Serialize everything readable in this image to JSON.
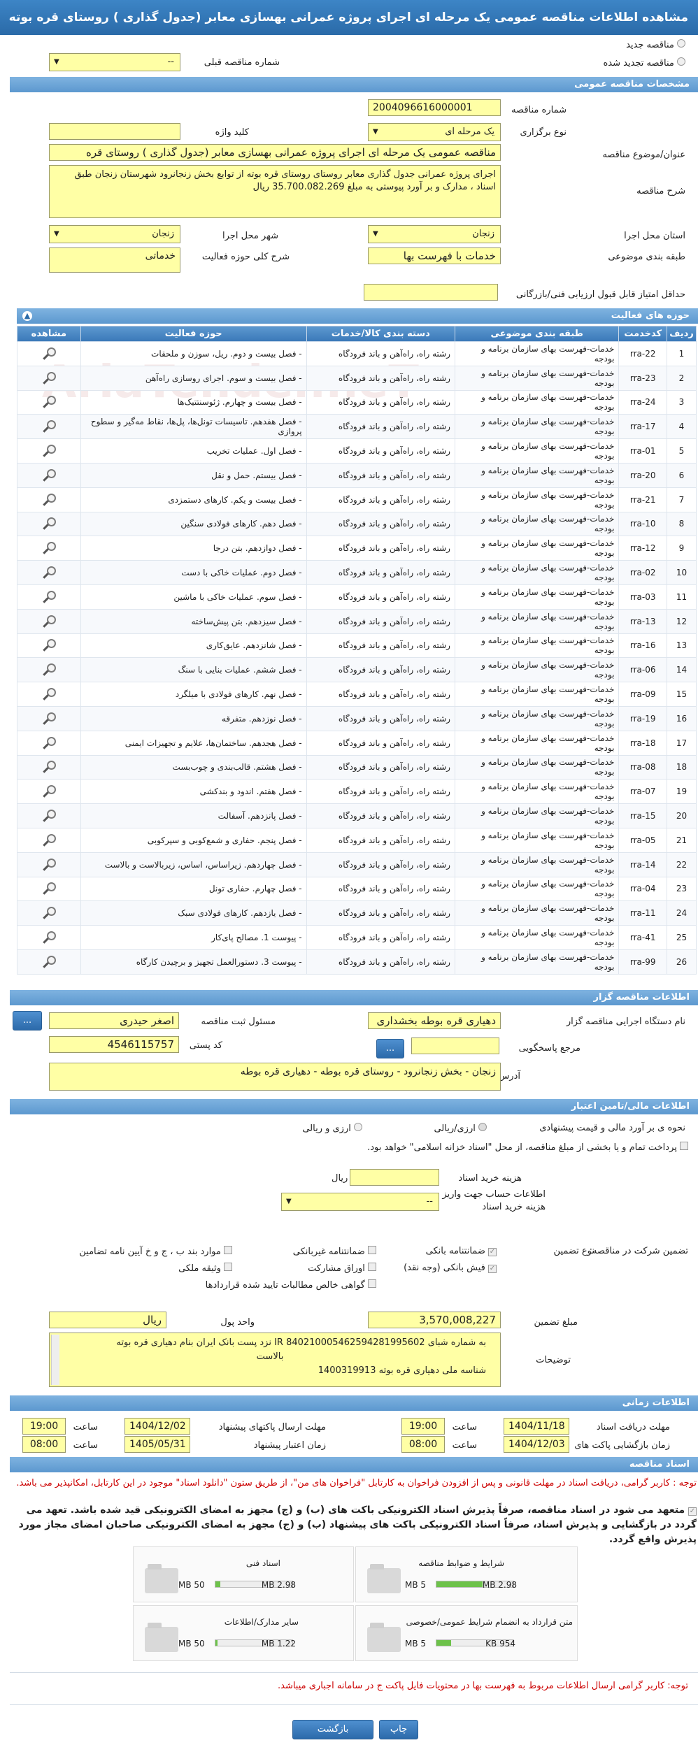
{
  "page": {
    "title": "مشاهده اطلاعات مناقصه عمومی یک مرحله ای اجرای پروژه عمرانی بهسازی معابر (جدول گذاری ) روستای قره بوته"
  },
  "tender_type": {
    "new_label": "مناقصه جدید",
    "renewed_label": "مناقصه تجدید شده",
    "prev_number_label": "شماره مناقصه قبلی",
    "prev_number_value": "--"
  },
  "general": {
    "header": "مشخصات مناقصه عمومی",
    "number_label": "شماره مناقصه",
    "number_value": "2004096616000001",
    "holding_label": "نوع برگزاری",
    "holding_value": "یک مرحله ای",
    "keyword_label": "کلید واژه",
    "keyword_value": "",
    "subject_label": "عنوان/موضوع مناقصه",
    "subject_value": "مناقصه عمومی یک مرحله ای اجرای پروژه عمرانی بهسازی معابر (جدول گذاری ) روستای قره",
    "desc_label": "شرح مناقصه",
    "desc_value": "اجرای پروژه عمرانی جدول گذاری معابر روستای روستای قره بوته از توابع بخش زنجانرود شهرستان زنجان طبق اسناد ، مدارک و بر آورد پیوستی به مبلغ 35.700.082.269 ریال",
    "province_label": "استان محل اجرا",
    "province_value": "زنجان",
    "city_label": "شهر محل اجرا",
    "city_value": "زنجان",
    "category_label": "طبقه بندی موضوعی",
    "category_value": "خدمات با فهرست بها",
    "activity_label": "شرح کلی حوزه فعالیت",
    "activity_value": "خدماتی",
    "min_score_label": "حداقل امتیاز قابل قبول ارزیابی فنی/بازرگانی",
    "min_score_value": ""
  },
  "activities": {
    "header": "حوزه های فعالیت",
    "columns": [
      "ردیف",
      "کدخدمت",
      "طبقه بندی موضوعی",
      "دسته بندی کالا/خدمات",
      "حوزه فعالیت",
      "مشاهده"
    ],
    "rows": [
      [
        "1",
        "rra-22",
        "خدمات-فهرست بهای سازمان برنامه و بودجه",
        "رشته راه، راه‌آهن و باند فرودگاه",
        "- فصل بیست و دوم. ریل، سوزن و ملحقات"
      ],
      [
        "2",
        "rra-23",
        "خدمات-فهرست بهای سازمان برنامه و بودجه",
        "رشته راه، راه‌آهن و باند فرودگاه",
        "- فصل بیست و سوم. اجرای روسازی راه‌آهن"
      ],
      [
        "3",
        "rra-24",
        "خدمات-فهرست بهای سازمان برنامه و بودجه",
        "رشته راه، راه‌آهن و باند فرودگاه",
        "- فصل بیست و چهارم. ژئوسنتتیک‌ها"
      ],
      [
        "4",
        "rra-17",
        "خدمات-فهرست بهای سازمان برنامه و بودجه",
        "رشته راه، راه‌آهن و باند فرودگاه",
        "- فصل هفدهم. تاسیسات تونل‌ها، پل‌ها، نقاط مه‌گیر و سطوح پروازی"
      ],
      [
        "5",
        "rra-01",
        "خدمات-فهرست بهای سازمان برنامه و بودجه",
        "رشته راه، راه‌آهن و باند فرودگاه",
        "- فصل اول. عملیات تخریب"
      ],
      [
        "6",
        "rra-20",
        "خدمات-فهرست بهای سازمان برنامه و بودجه",
        "رشته راه، راه‌آهن و باند فرودگاه",
        "- فصل بیستم. حمل و نقل"
      ],
      [
        "7",
        "rra-21",
        "خدمات-فهرست بهای سازمان برنامه و بودجه",
        "رشته راه، راه‌آهن و باند فرودگاه",
        "- فصل بیست و یکم. کارهای دستمزدی"
      ],
      [
        "8",
        "rra-10",
        "خدمات-فهرست بهای سازمان برنامه و بودجه",
        "رشته راه، راه‌آهن و باند فرودگاه",
        "- فصل دهم. کارهای فولادی سنگین"
      ],
      [
        "9",
        "rra-12",
        "خدمات-فهرست بهای سازمان برنامه و بودجه",
        "رشته راه، راه‌آهن و باند فرودگاه",
        "- فصل دوازدهم. بتن درجا"
      ],
      [
        "10",
        "rra-02",
        "خدمات-فهرست بهای سازمان برنامه و بودجه",
        "رشته راه، راه‌آهن و باند فرودگاه",
        "- فصل دوم. عملیات خاکی با دست"
      ],
      [
        "11",
        "rra-03",
        "خدمات-فهرست بهای سازمان برنامه و بودجه",
        "رشته راه، راه‌آهن و باند فرودگاه",
        "- فصل سوم. عملیات خاکی با ماشین"
      ],
      [
        "12",
        "rra-13",
        "خدمات-فهرست بهای سازمان برنامه و بودجه",
        "رشته راه، راه‌آهن و باند فرودگاه",
        "- فصل سیزدهم. بتن پیش‌ساخته"
      ],
      [
        "13",
        "rra-16",
        "خدمات-فهرست بهای سازمان برنامه و بودجه",
        "رشته راه، راه‌آهن و باند فرودگاه",
        "- فصل شانزدهم. عایق‌کاری"
      ],
      [
        "14",
        "rra-06",
        "خدمات-فهرست بهای سازمان برنامه و بودجه",
        "رشته راه، راه‌آهن و باند فرودگاه",
        "- فصل ششم. عملیات بنایی با سنگ"
      ],
      [
        "15",
        "rra-09",
        "خدمات-فهرست بهای سازمان برنامه و بودجه",
        "رشته راه، راه‌آهن و باند فرودگاه",
        "- فصل نهم. کارهای فولادی با میلگرد"
      ],
      [
        "16",
        "rra-19",
        "خدمات-فهرست بهای سازمان برنامه و بودجه",
        "رشته راه، راه‌آهن و باند فرودگاه",
        "- فصل نوزدهم. متفرقه"
      ],
      [
        "17",
        "rra-18",
        "خدمات-فهرست بهای سازمان برنامه و بودجه",
        "رشته راه، راه‌آهن و باند فرودگاه",
        "- فصل هجدهم. ساختمان‌ها، علایم و تجهیزات ایمنی"
      ],
      [
        "18",
        "rra-08",
        "خدمات-فهرست بهای سازمان برنامه و بودجه",
        "رشته راه، راه‌آهن و باند فرودگاه",
        "- فصل هشتم. قالب‌بندی و چوب‌بست"
      ],
      [
        "19",
        "rra-07",
        "خدمات-فهرست بهای سازمان برنامه و بودجه",
        "رشته راه، راه‌آهن و باند فرودگاه",
        "- فصل هفتم. اندود و بندکشی"
      ],
      [
        "20",
        "rra-15",
        "خدمات-فهرست بهای سازمان برنامه و بودجه",
        "رشته راه، راه‌آهن و باند فرودگاه",
        "- فصل پانزدهم. آسفالت"
      ],
      [
        "21",
        "rra-05",
        "خدمات-فهرست بهای سازمان برنامه و بودجه",
        "رشته راه، راه‌آهن و باند فرودگاه",
        "- فصل پنجم. حفاری و شمع‌کوبی و سپرکوبی"
      ],
      [
        "22",
        "rra-14",
        "خدمات-فهرست بهای سازمان برنامه و بودجه",
        "رشته راه، راه‌آهن و باند فرودگاه",
        "- فصل چهاردهم. زیراساس، اساس، زیربالاست و بالاست"
      ],
      [
        "23",
        "rra-04",
        "خدمات-فهرست بهای سازمان برنامه و بودجه",
        "رشته راه، راه‌آهن و باند فرودگاه",
        "- فصل چهارم. حفاری تونل"
      ],
      [
        "24",
        "rra-11",
        "خدمات-فهرست بهای سازمان برنامه و بودجه",
        "رشته راه، راه‌آهن و باند فرودگاه",
        "- فصل یازدهم. کارهای فولادی سبک"
      ],
      [
        "25",
        "rra-41",
        "خدمات-فهرست بهای سازمان برنامه و بودجه",
        "رشته راه، راه‌آهن و باند فرودگاه",
        "- پیوست 1. مصالح پای‌کار"
      ],
      [
        "26",
        "rra-99",
        "خدمات-فهرست بهای سازمان برنامه و بودجه",
        "رشته راه، راه‌آهن و باند فرودگاه",
        "- پیوست 3. دستورالعمل تجهیز و برچیدن کارگاه"
      ]
    ]
  },
  "organizer": {
    "header": "اطلاعات مناقصه گزار",
    "org_label": "نام دستگاه اجرایی مناقصه گزار",
    "org_value": "دهیاری قره بوطه بخشداری",
    "registrar_label": "مسئول ثبت مناقصه",
    "registrar_value": "اصغر حیدری",
    "ref_label": "مرجع پاسخگویی",
    "ref_value": "",
    "postal_label": "کد پستی",
    "postal_value": "4546115757",
    "address_label": "آدرس",
    "address_value": "زنجان - بخش زنجانرود - روستای قره بوطه - دهیاری قره بوطه",
    "dots": "..."
  },
  "finance": {
    "header": "اطلاعات مالی/تامین اعتبار",
    "method_label": "نحوه ی بر آورد مالی و قیمت پیشنهادی",
    "opt1": "ارزی/ریالی",
    "opt2": "ارزی و ریالی",
    "treasury_text": "پرداخت تمام و یا بخشی از مبلغ مناقصه، از محل \"اسناد خزانه اسلامی\" خواهد بود.",
    "doc_fee_label": "هزینه خرید اسناد",
    "doc_fee_value": "",
    "rial_unit": "ریال",
    "account_label": "اطلاعات حساب جهت واریز هزینه خرید اسناد",
    "account_value": "--",
    "guarantee_label": "تضمین شرکت در مناقصه:",
    "guarantee_type_label": "نوع تضمین",
    "g1": "ضمانتنامه بانکی",
    "g2": "ضمانتنامه غیربانکی",
    "g3": "موارد بند ب ، ج و خ آیین نامه تضامین",
    "g4": "فیش بانکی (وجه نقد)",
    "g5": "اوراق مشارکت",
    "g6": "وثیقه ملکی",
    "g7": "گواهی خالص مطالبات تایید شده قراردادها",
    "amount_label": "مبلغ تضمین",
    "amount_value": "3,570,008,227",
    "unit_label": "واحد پول",
    "unit_value": "ریال",
    "notes_label": "توضیحات",
    "notes_line1": "به شماره شبای IR 840210005462594281995602 نزد پست بانک ایران بنام دهیاری قره بوته",
    "notes_line2": "بالاست",
    "notes_line3": "شناسه ملی دهیاری قره بوته 1400319913"
  },
  "timing": {
    "header": "اطلاعات زمانی",
    "recv_label": "مهلت دریافت اسناد",
    "recv_date": "1404/11/18",
    "recv_time": "19:00",
    "send_label": "مهلت ارسال پاکتهای پیشنهاد",
    "send_date": "1404/12/02",
    "send_time": "19:00",
    "open_label": "زمان بازگشایی پاکت های",
    "open_date": "1404/12/03",
    "open_time": "08:00",
    "valid_label": "زمان اعتبار پیشنهاد",
    "valid_date": "1405/05/31",
    "valid_time": "08:00",
    "time_label": "ساعت"
  },
  "docs": {
    "header": "اسناد مناقصه",
    "note_red": "توجه : کاربر گرامی، دریافت اسناد در مهلت قانونی و پس از افزودن فراخوان به کارتابل \"فراخوان های من\"، از طریق ستون \"دانلود اسناد\" موجود در این کارتابل، امکانپذیر می باشد.",
    "commit_text": "متعهد می شود در اسناد مناقصه، صرفاً پذیرش اسناد الکترونیکی باکت های (ب) و (ج) مجهز به امضای الکترونیکی قید شده باشد. تعهد می گردد در بازگشایی و پذیرش اسناد، صرفاً اسناد الکترونیکی باکت های پیشنهاد (ب) و (ج) مجهز به امضای الکترونیکی صاحبان امضای مجاز مورد پذیرش واقع گردد.",
    "files": [
      {
        "title": "شرایط و ضوابط مناقصه",
        "limit": "5 MB",
        "used": "2.98 MB",
        "fraction": 0.6
      },
      {
        "title": "اسناد فنی",
        "limit": "50 MB",
        "used": "2.98 MB",
        "fraction": 0.06
      },
      {
        "title": "متن قرارداد به انضمام شرایط عمومی/خصوصی",
        "limit": "5 MB",
        "used": "954 KB",
        "fraction": 0.19
      },
      {
        "title": "سایر مدارک/اطلاعات",
        "limit": "50 MB",
        "used": "1.22 MB",
        "fraction": 0.03
      }
    ],
    "bottom_note": "توجه: کاربر گرامی ارسال اطلاعات مربوط به فهرست بها در محتویات فایل پاکت ج در سامانه اجباری میباشد."
  },
  "actions": {
    "print": "چاپ",
    "back": "بازگشت"
  },
  "colors": {
    "header_blue": "#2a6aa8",
    "field_yellow": "#ffffa5",
    "progress_green": "#6dc24a",
    "note_red": "#cc0000"
  }
}
